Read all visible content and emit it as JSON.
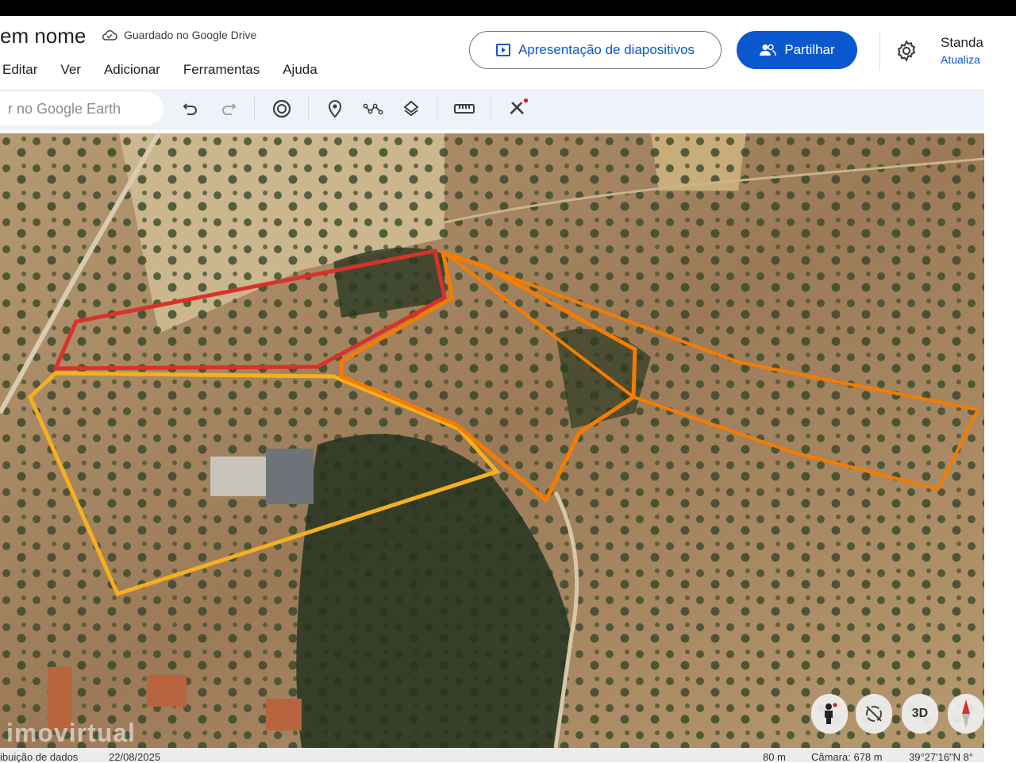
{
  "header": {
    "title": "em nome",
    "saved_status": "Guardado no Google Drive",
    "slideshow_label": "Apresentação de diapositivos",
    "share_label": "Partilhar",
    "style_label": "Standa",
    "update_label": "Atualiza"
  },
  "menu": [
    "Editar",
    "Ver",
    "Adicionar",
    "Ferramentas",
    "Ajuda"
  ],
  "toolbar": {
    "search_placeholder": "r no Google Earth"
  },
  "colors": {
    "accent": "#0b57d0",
    "red_polygon": "#d8322a",
    "orange_polygon": "#f57c00",
    "yellow_polygon": "#f5b020"
  },
  "map": {
    "watermark": "imovirtual",
    "controls": {
      "three_d": "3D"
    }
  },
  "status": {
    "attribution": "ibuição de dados",
    "date": "22/08/2025",
    "scale": "80 m",
    "camera": "Câmara: 678 m",
    "coords": "39°27'16\"N 8°"
  }
}
